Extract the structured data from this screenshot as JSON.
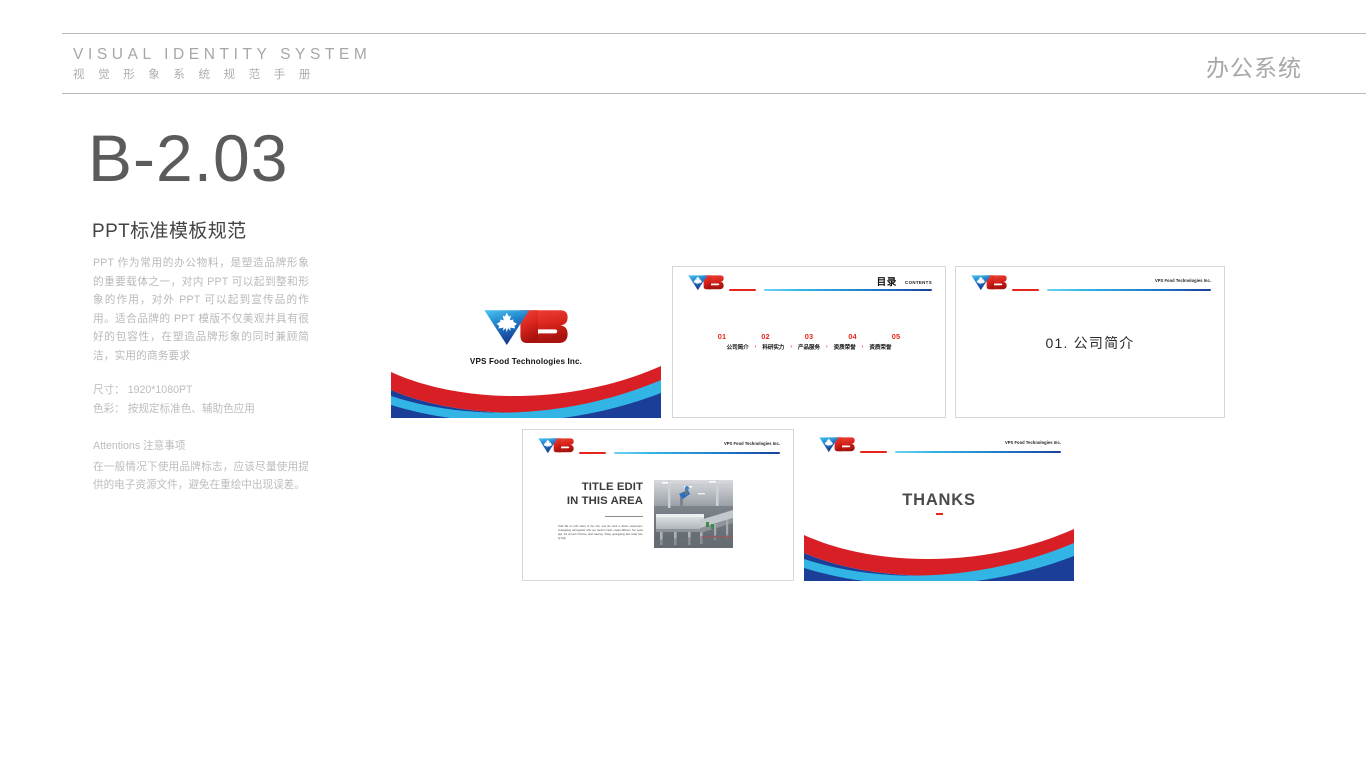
{
  "header": {
    "title_en": "VISUAL IDENTITY SYSTEM",
    "title_cn": "视 觉 形 象 系 统 规 范 手 册",
    "section_cn": "办公系统"
  },
  "left_column": {
    "code": "B-2.03",
    "section_title": "PPT标准模板规范",
    "body": "PPT 作为常用的办公物料，是塑造品牌形象的重要载体之一，对内 PPT 可以起到整和形象的作用，对外 PPT 可以起到宣传品的作用。适合品牌的 PPT 模版不仅美观并具有很好的包容性，在塑造品牌形象的同时兼顾简洁，实用的商务要求",
    "spec_size": "尺寸： 1920*1080PT",
    "spec_color": "色彩： 按规定标准色、辅助色应用",
    "attentions_head": "Attentions 注意事项",
    "attentions_body": "在一般情况下使用品牌标志，应该尽量使用提供的电子资源文件，避免在重绘中出现误差。"
  },
  "brand": {
    "logo_text": "VPS",
    "company_name": "VPS Food Technologies Inc.",
    "colors": {
      "red": "#e8251c",
      "cyan": "#35b6e6",
      "light_cyan": "#6fd2f0",
      "blue": "#1b3f98",
      "deep_blue": "#1d4f9e",
      "gray_rule": "#b8b8b8"
    }
  },
  "slides": {
    "cover": {
      "name": "cover-slide",
      "company_name": "VPS Food Technologies Inc."
    },
    "contents": {
      "name": "contents-slide",
      "title_cn": "目录",
      "title_en": "CONTENTS",
      "items": [
        {
          "number": "01",
          "label": "公司简介"
        },
        {
          "number": "02",
          "label": "科研实力"
        },
        {
          "number": "03",
          "label": "产品服务"
        },
        {
          "number": "04",
          "label": "资质荣誉"
        },
        {
          "number": "05",
          "label": "资质荣誉"
        }
      ],
      "separator": "›"
    },
    "section_divider": {
      "name": "section-divider-slide",
      "header_right": "VPS Food Technologies Inc.",
      "title": "01. 公司简介"
    },
    "content": {
      "name": "content-slide",
      "header_right": "VPS Food Technologies Inc.",
      "title_line1": "TITLE EDIT",
      "title_line2": "IN THIS AREA",
      "body": "Tidal flat on both sides of the rich, and the wind is blown suspension. Guangdong will together with you, hand in hand, create different. Ten years ago, the proverb rhizome, land catering. Today, guangdong also today fast, fly high.",
      "photo_alt": "factory-production-line-photo"
    },
    "thanks": {
      "name": "thanks-slide",
      "header_right": "VPS Food Technologies Inc.",
      "text": "THANKS"
    }
  }
}
